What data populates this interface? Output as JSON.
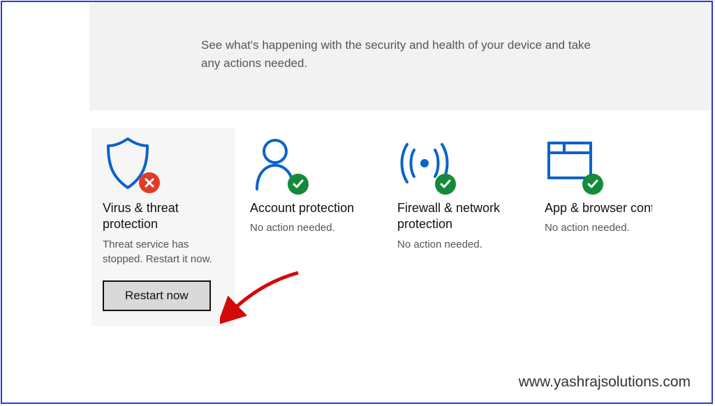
{
  "intro_text": "See what's happening with the security and health of your device and take any actions needed.",
  "tiles": {
    "virus": {
      "title": "Virus & threat protection",
      "status": "Threat service has stopped. Restart it now.",
      "button_label": "Restart now"
    },
    "account": {
      "title": "Account protection",
      "status": "No action needed."
    },
    "firewall": {
      "title": "Firewall & network protection",
      "status": "No action needed."
    },
    "app": {
      "title": "App & browser control",
      "status": "No action needed."
    }
  },
  "watermark": "www.yashrajsolutions.com",
  "colors": {
    "accent": "#0a64c8",
    "frame": "#2b3bd6",
    "ok": "#148a3b",
    "err": "#e23b25",
    "arrow": "#d20a0a"
  }
}
